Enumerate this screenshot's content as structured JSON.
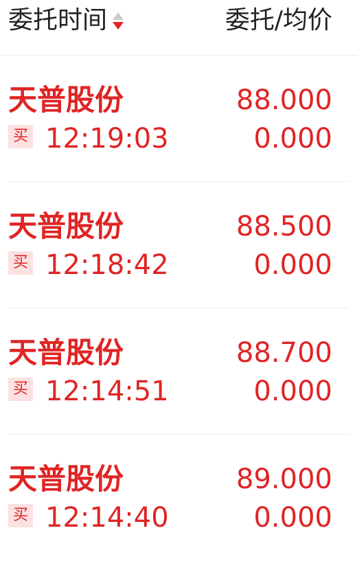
{
  "header": {
    "time_label": "委托时间",
    "price_label": "委托/均价"
  },
  "colors": {
    "buy_red": "#e02424",
    "sort_inactive": "#c9c9c9",
    "badge_bg": "#fbe1e1"
  },
  "icons": {
    "sort": "sort-icon"
  },
  "orders": [
    {
      "name": "天普股份",
      "side": "买",
      "time": "12:19:03",
      "price": "88.000",
      "avg": "0.000"
    },
    {
      "name": "天普股份",
      "side": "买",
      "time": "12:18:42",
      "price": "88.500",
      "avg": "0.000"
    },
    {
      "name": "天普股份",
      "side": "买",
      "time": "12:14:51",
      "price": "88.700",
      "avg": "0.000"
    },
    {
      "name": "天普股份",
      "side": "买",
      "time": "12:14:40",
      "price": "89.000",
      "avg": "0.000"
    }
  ]
}
